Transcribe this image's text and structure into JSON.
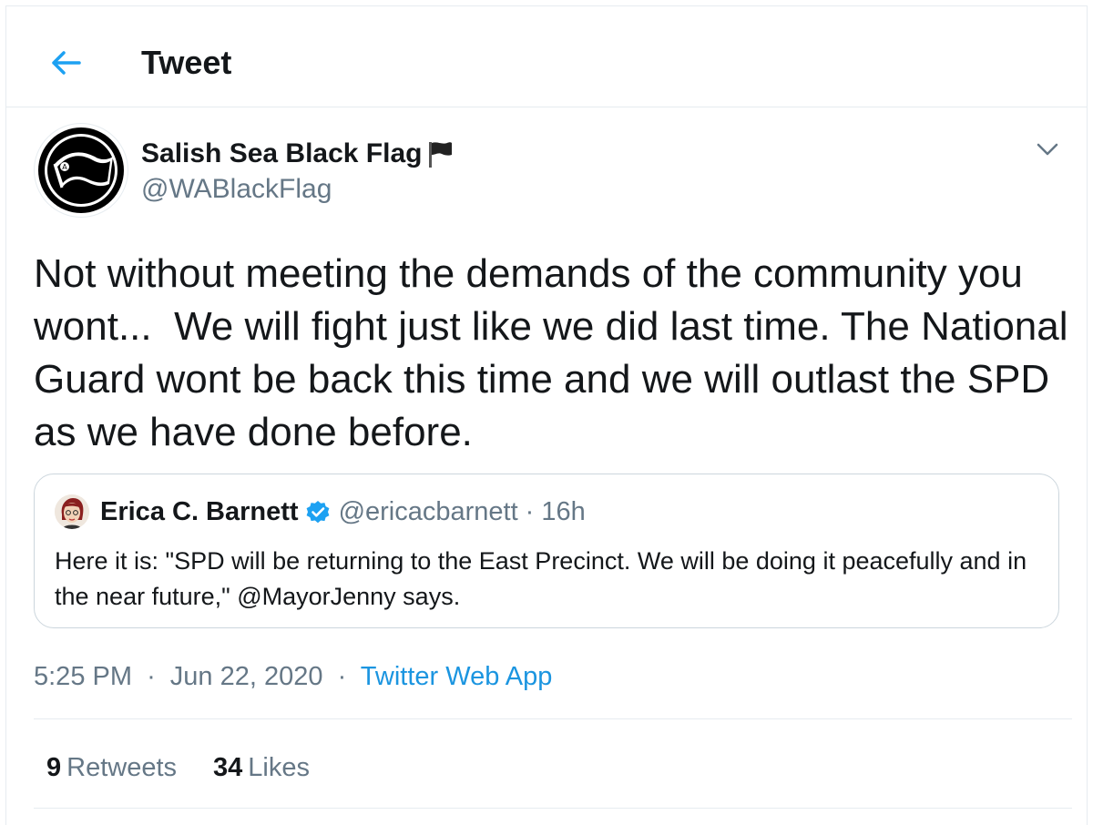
{
  "header": {
    "title": "Tweet",
    "back_icon": "back-arrow-icon",
    "accent_color": "#1da1f2"
  },
  "tweet": {
    "author": {
      "display_name": "Salish Sea Black Flag",
      "emoji_icon": "black-flag-icon",
      "handle": "@WABlackFlag",
      "avatar_icon": "anarchist-black-flag-logo"
    },
    "menu_icon": "chevron-down-icon",
    "text": "Not without meeting the demands of the community you wont...  We will fight just like we did last time. The National Guard wont be back this time and we will outlast the SPD as we have done before.",
    "quoted": {
      "name": "Erica C. Barnett",
      "verified_icon": "verified-badge-icon",
      "handle": "@ericacbarnett",
      "separator": "·",
      "time": "16h",
      "text": "Here it is: \"SPD will be returning to the East Precinct. We will be doing it peacefully and in the near future,\" @MayorJenny says."
    },
    "time": "5:25 PM",
    "separator": "·",
    "date": "Jun 22, 2020",
    "source": "Twitter Web App",
    "retweets_count": "9",
    "retweets_label": "Retweets",
    "likes_count": "34",
    "likes_label": "Likes"
  },
  "colors": {
    "text": "#14171a",
    "secondary": "#657786",
    "link": "#1b95e0",
    "border": "#e6ecf0",
    "verified": "#1da1f2"
  }
}
